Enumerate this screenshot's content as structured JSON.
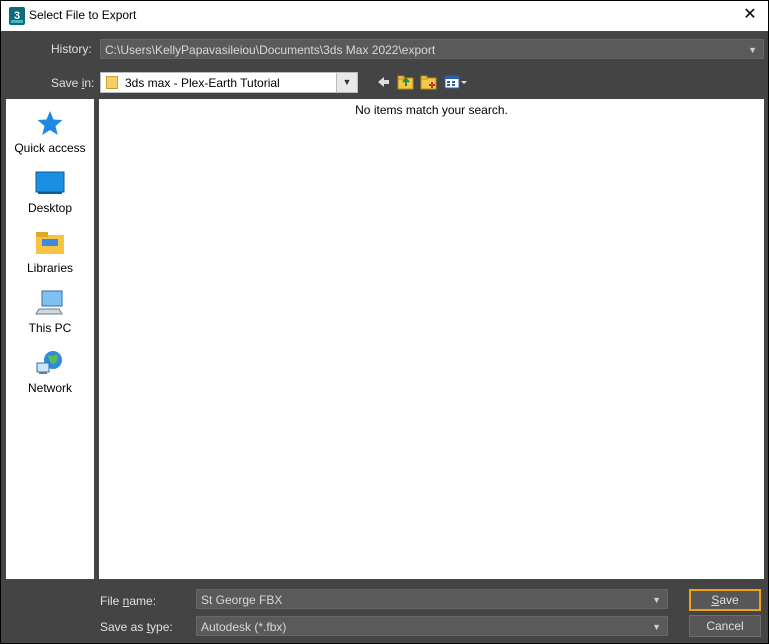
{
  "window": {
    "title": "Select File to Export",
    "app_icon_glyph": "3"
  },
  "history": {
    "label": "History:",
    "value": "C:\\Users\\KellyPapavasileiou\\Documents\\3ds Max 2022\\export"
  },
  "save_in": {
    "label_pre": "Save ",
    "label_u": "i",
    "label_post": "n:",
    "value": "3ds max - Plex-Earth Tutorial"
  },
  "places": [
    {
      "label": "Quick access",
      "icon": "star-icon"
    },
    {
      "label": "Desktop",
      "icon": "desktop-icon"
    },
    {
      "label": "Libraries",
      "icon": "libraries-icon"
    },
    {
      "label": "This PC",
      "icon": "computer-icon"
    },
    {
      "label": "Network",
      "icon": "network-icon"
    }
  ],
  "file_list": {
    "empty_message": "No items match your search."
  },
  "file_name": {
    "label_pre": "File ",
    "label_u": "n",
    "label_post": "ame:",
    "value": "St George FBX"
  },
  "save_as_type": {
    "label_pre": "Save as ",
    "label_u": "t",
    "label_post": "ype:",
    "value": "Autodesk (*.fbx)"
  },
  "buttons": {
    "save_u": "S",
    "save_rest": "ave",
    "cancel": "Cancel"
  },
  "colors": {
    "accent": "#f0a30a",
    "dialog_bg": "#444444",
    "field_bg": "#5a5a5a"
  }
}
